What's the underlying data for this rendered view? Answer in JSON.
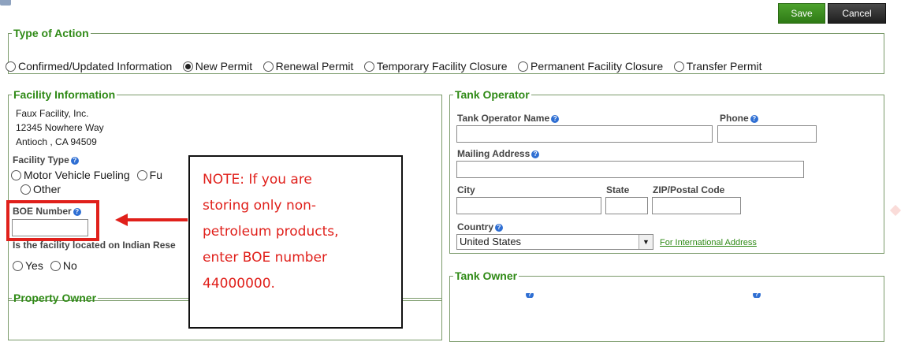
{
  "toolbar": {
    "save_label": "Save",
    "cancel_label": "Cancel"
  },
  "type_of_action": {
    "legend": "Type of Action",
    "options": [
      {
        "label": "Confirmed/Updated Information",
        "selected": false
      },
      {
        "label": "New Permit",
        "selected": true
      },
      {
        "label": "Renewal Permit",
        "selected": false
      },
      {
        "label": "Temporary Facility Closure",
        "selected": false
      },
      {
        "label": "Permanent Facility Closure",
        "selected": false
      },
      {
        "label": "Transfer Permit",
        "selected": false
      }
    ]
  },
  "facility": {
    "legend": "Facility Information",
    "name": "Faux Facility, Inc.",
    "street": "12345 Nowhere Way",
    "city_line": "Antioch , CA 94509",
    "type_label": "Facility Type",
    "type_opt1": "Motor Vehicle Fueling",
    "type_opt2": "Fu",
    "type_opt3": "Other",
    "boe_label": "BOE Number",
    "boe_value": "",
    "indian_question": "Is the facility located on Indian Rese",
    "yes_label": "Yes",
    "no_label": "No"
  },
  "property_owner": {
    "legend": "Property Owner"
  },
  "tank_operator": {
    "legend": "Tank Operator",
    "name_label": "Tank Operator Name",
    "phone_label": "Phone",
    "mailing_label": "Mailing Address",
    "city_label": "City",
    "state_label": "State",
    "zip_label": "ZIP/Postal Code",
    "country_label": "Country",
    "country_value": "United States",
    "intl_link": "For International Address"
  },
  "tank_owner": {
    "legend": "Tank Owner"
  },
  "callout": {
    "lines": [
      "NOTE: If you are",
      "storing only non-",
      "petroleum products,",
      "enter BOE number",
      "44000000."
    ]
  },
  "colors": {
    "accent_green": "#2f8a16",
    "save_green": "#3a8a1e",
    "cancel_dark": "#2b2b2b",
    "callout_red": "#e0201b"
  }
}
